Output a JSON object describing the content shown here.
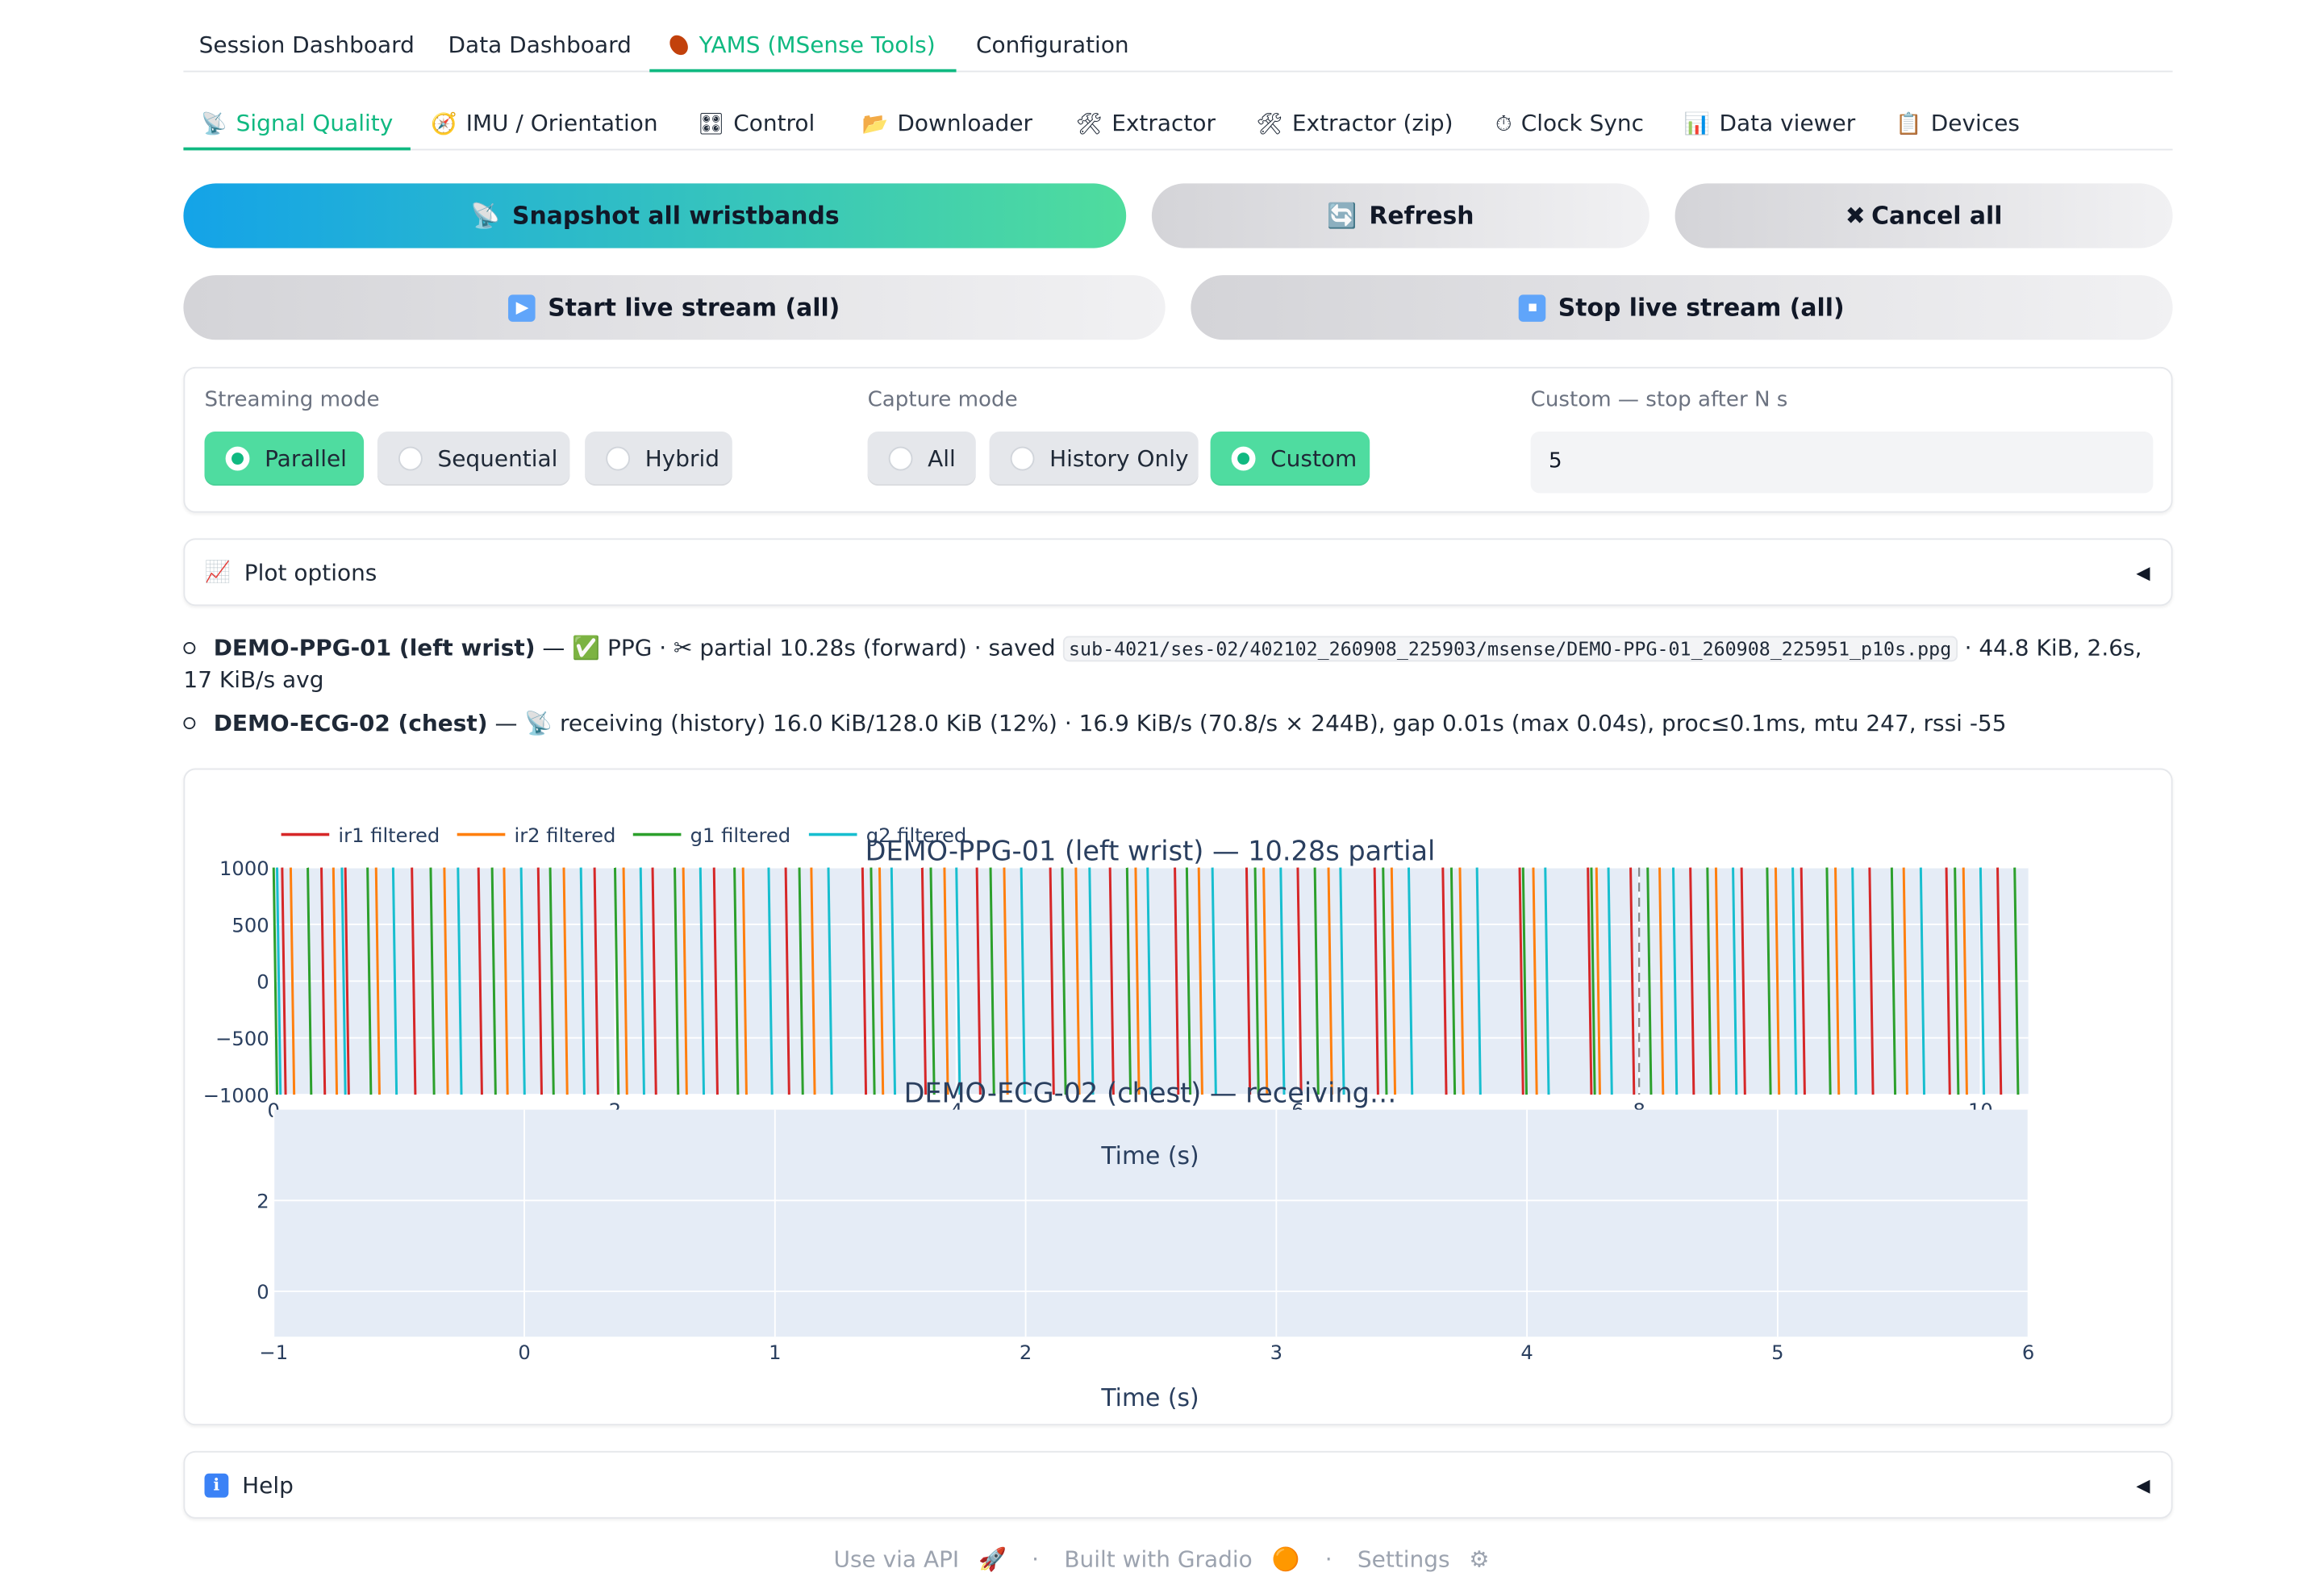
{
  "top_tabs": [
    {
      "label": "Session Dashboard",
      "icon": ""
    },
    {
      "label": "Data Dashboard",
      "icon": ""
    },
    {
      "label": "YAMS (MSense Tools)",
      "icon": "sweet-potato-icon"
    },
    {
      "label": "Configuration",
      "icon": ""
    }
  ],
  "top_active": 2,
  "sub_tabs": [
    {
      "label": "Signal Quality",
      "icon": "satellite-icon",
      "glyph": "📡"
    },
    {
      "label": "IMU / Orientation",
      "icon": "compass-icon",
      "glyph": "🧭"
    },
    {
      "label": "Control",
      "icon": "control-knobs-icon",
      "glyph": "🎛"
    },
    {
      "label": "Downloader",
      "icon": "folder-icon",
      "glyph": "📂"
    },
    {
      "label": "Extractor",
      "icon": "tools-icon",
      "glyph": "🛠"
    },
    {
      "label": "Extractor (zip)",
      "icon": "tools-icon",
      "glyph": "🛠"
    },
    {
      "label": "Clock Sync",
      "icon": "stopwatch-icon",
      "glyph": "⏱"
    },
    {
      "label": "Data viewer",
      "icon": "bar-chart-icon",
      "glyph": "📊"
    },
    {
      "label": "Devices",
      "icon": "clipboard-icon",
      "glyph": "📋"
    }
  ],
  "sub_active": 0,
  "buttons": {
    "snapshot": {
      "label": "Snapshot all wristbands",
      "glyph": "📡"
    },
    "refresh": {
      "label": "Refresh",
      "glyph": "🔄"
    },
    "cancel": {
      "label": "Cancel all",
      "glyph": "✖"
    },
    "start": {
      "label": "Start live stream (all)",
      "glyph": "▶"
    },
    "stop": {
      "label": "Stop live stream (all)",
      "glyph": "⏹"
    }
  },
  "options": {
    "streaming_label": "Streaming mode",
    "streaming": [
      "Parallel",
      "Sequential",
      "Hybrid"
    ],
    "streaming_selected": 0,
    "capture_label": "Capture mode",
    "capture": [
      "All",
      "History Only",
      "Custom"
    ],
    "capture_selected": 2,
    "custom_label": "Custom — stop after N s",
    "custom_value": "5"
  },
  "plot_options": {
    "label": "Plot options",
    "glyph": "📈"
  },
  "status": [
    {
      "device": "DEMO-PPG-01 (left wrist)",
      "sep": " — ",
      "glyph": "✅",
      "pre": " PPG · ✂ partial 10.28s (forward) · saved ",
      "path": "sub-4021/ses-02/402102_260908_225903/msense/DEMO-PPG-01_260908_225951_p10s.ppg",
      "post": " · 44.8 KiB, 2.6s, 17 KiB/s avg"
    },
    {
      "device": "DEMO-ECG-02 (chest)",
      "sep": " — ",
      "glyph": "📡",
      "pre": " receiving (history) 16.0 KiB/128.0 KiB (12%) · 16.9 KiB/s (70.8/s × 244B), gap 0.01s (max 0.04s), proc≤0.1ms, mtu 247, rssi -55"
    }
  ],
  "chart_data": [
    {
      "type": "line",
      "title": "DEMO-PPG-01 (left wrist) — 10.28s partial",
      "xlabel": "",
      "ylabel": "",
      "xlim": [
        0,
        10.28
      ],
      "ylim": [
        -1000,
        1000
      ],
      "x_ticks": [
        0,
        2,
        4,
        6,
        8,
        10
      ],
      "x_tick_labels": [
        "0",
        "2",
        "4",
        "6",
        "8",
        "10"
      ],
      "y_ticks": [
        1000,
        500,
        0,
        -500,
        -1000
      ],
      "y_tick_labels": [
        "1000",
        "500",
        "0",
        "−500",
        "−1000"
      ],
      "legend": "top-left",
      "grid": true,
      "vline_x": 8,
      "series": [
        {
          "name": "ir1 filtered",
          "color": "#d62728",
          "crossings": [
            0.05,
            0.28,
            0.42,
            0.81,
            1.2,
            1.55,
            1.88,
            2.22,
            2.58,
            3.0,
            3.45,
            3.8,
            4.12,
            4.55,
            4.9,
            5.28,
            5.7,
            6.0,
            6.45,
            6.85,
            7.3,
            7.7,
            7.95,
            8.3,
            8.6,
            8.95,
            9.35,
            9.8,
            10.1
          ]
        },
        {
          "name": "ir2 filtered",
          "color": "#ff7f0e",
          "crossings": [
            0.1,
            0.35,
            0.6,
            1.0,
            1.35,
            1.7,
            2.05,
            2.4,
            2.75,
            3.15,
            3.55,
            3.93,
            4.28,
            4.7,
            5.05,
            5.42,
            5.8,
            6.18,
            6.55,
            6.95,
            7.38,
            7.75,
            8.12,
            8.45,
            8.8,
            9.15,
            9.55,
            9.9
          ]
        },
        {
          "name": "g1 filtered",
          "color": "#2ca02c",
          "crossings": [
            0.0,
            0.2,
            0.55,
            0.92,
            1.28,
            1.62,
            2.0,
            2.35,
            2.7,
            3.08,
            3.5,
            3.85,
            4.2,
            4.62,
            5.0,
            5.35,
            5.75,
            6.1,
            6.5,
            6.9,
            7.32,
            7.72,
            8.05,
            8.4,
            8.75,
            9.1,
            9.48,
            9.85,
            10.2
          ]
        },
        {
          "name": "g2 filtered",
          "color": "#17becf",
          "crossings": [
            0.02,
            0.4,
            0.7,
            1.08,
            1.45,
            1.8,
            2.15,
            2.5,
            2.9,
            3.25,
            3.62,
            4.0,
            4.38,
            4.78,
            5.12,
            5.5,
            5.9,
            6.25,
            6.65,
            7.05,
            7.45,
            7.82,
            8.2,
            8.55,
            8.9,
            9.25,
            9.65,
            10.0
          ]
        }
      ]
    },
    {
      "type": "line",
      "title": "DEMO-ECG-02 (chest) — receiving…",
      "xlabel": "Time (s)",
      "ylabel": "",
      "xlim": [
        -1,
        6
      ],
      "ylim": [
        -1,
        4
      ],
      "x_ticks": [
        -1,
        0,
        1,
        2,
        3,
        4,
        5,
        6
      ],
      "x_tick_labels": [
        "−1",
        "0",
        "1",
        "2",
        "3",
        "4",
        "5",
        "6"
      ],
      "y_ticks": [
        2,
        0
      ],
      "y_tick_labels": [
        "2",
        "0"
      ],
      "grid": true,
      "series": []
    }
  ],
  "shared_xlabel": "Time (s)",
  "help": {
    "label": "Help",
    "glyph": "ℹ"
  },
  "footer": {
    "api": "Use via API",
    "api_glyph": "🚀",
    "built": "Built with Gradio",
    "built_glyph": "🟠",
    "settings": "Settings",
    "settings_glyph": "⚙",
    "dot": "·"
  }
}
